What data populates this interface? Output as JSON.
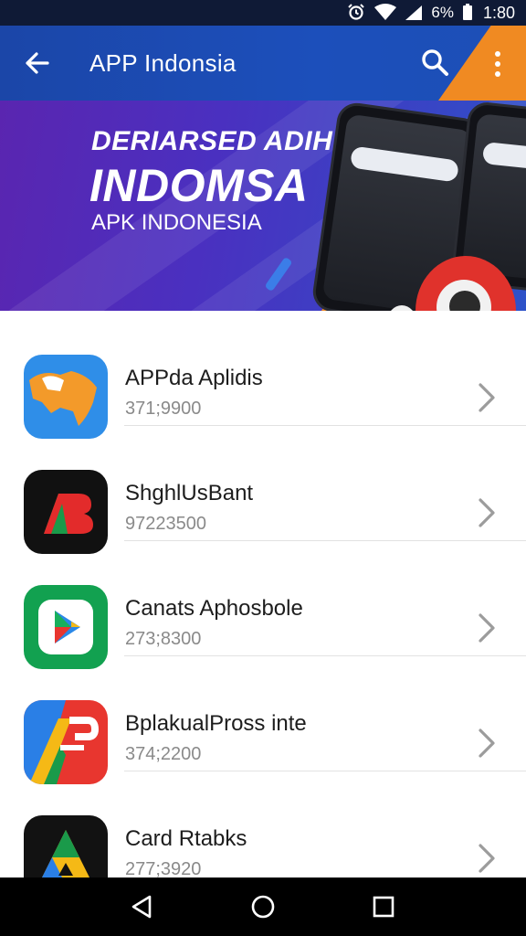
{
  "status_bar": {
    "battery": "6%",
    "time": "1:80",
    "icons": [
      "alarm-icon",
      "wifi-icon",
      "signal-icon",
      "battery-icon"
    ]
  },
  "app_bar": {
    "title": "APP Indonsia",
    "back_icon": "arrow-left-icon",
    "search_icon": "search-icon",
    "more_icon": "more-vert-icon"
  },
  "banner": {
    "line1": "DERIARSED ADIHH",
    "line2": "INDOMSA",
    "line3": "APK INDONESIA"
  },
  "apps": [
    {
      "name": "APPda Aplidis",
      "subtitle": "371;9900",
      "icon": "map-app-icon",
      "icon_bg": "#2f8ee8"
    },
    {
      "name": "ShghlUsBant",
      "subtitle": "97223500",
      "icon": "b-letter-app-icon",
      "icon_bg": "#111111"
    },
    {
      "name": "Canats Aphosbole",
      "subtitle": "273;8300",
      "icon": "play-app-icon",
      "icon_bg": "#12a150"
    },
    {
      "name": "BplakualPross inte",
      "subtitle": "374;2200",
      "icon": "a-letter-app-icon",
      "icon_bg": "#e8362f"
    },
    {
      "name": "Card Rtabks",
      "subtitle": "277;3920",
      "icon": "triangle-app-icon",
      "icon_bg": "#121212"
    }
  ],
  "colors": {
    "app_bar": "#1c4fbb",
    "accent_orange": "#f08a22",
    "banner_purple": "#5a25b0"
  },
  "nav_bar": {
    "icons": [
      "nav-back-icon",
      "nav-home-icon",
      "nav-recents-icon"
    ]
  }
}
